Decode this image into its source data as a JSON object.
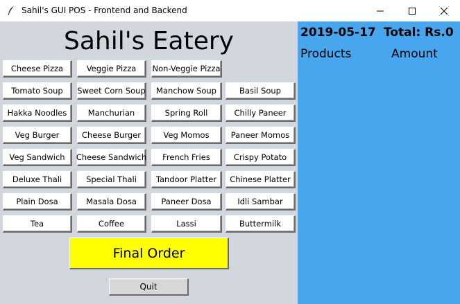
{
  "window": {
    "title": "Sahil's GUI POS - Frontend and Backend"
  },
  "shop": {
    "name": "Sahil's Eatery"
  },
  "menu": [
    [
      "Cheese Pizza",
      "Veggie Pizza",
      "Non-Veggie Pizza"
    ],
    [
      "Tomato Soup",
      "Sweet Corn Soup",
      "Manchow Soup",
      "Basil Soup"
    ],
    [
      "Hakka Noodles",
      "Manchurian",
      "Spring Roll",
      "Chilly Paneer"
    ],
    [
      "Veg Burger",
      "Cheese Burger",
      "Veg Momos",
      "Paneer Momos"
    ],
    [
      "Veg Sandwich",
      "Cheese Sandwich",
      "French Fries",
      "Crispy Potato"
    ],
    [
      "Deluxe Thali",
      "Special Thali",
      "Tandoor Platter",
      "Chinese Platter"
    ],
    [
      "Plain Dosa",
      "Masala Dosa",
      "Paneer Dosa",
      "Idli Sambar"
    ],
    [
      "Tea",
      "Coffee",
      "Lassi",
      "Buttermilk"
    ]
  ],
  "actions": {
    "final_order": "Final Order",
    "quit": "Quit"
  },
  "order": {
    "date": "2019-05-17",
    "total": "Total: Rs.0",
    "products_header": "Products",
    "amount_header": "Amount"
  },
  "colors": {
    "left_bg": "#d2d7df",
    "right_bg": "#47a6ee",
    "final_order_bg": "#ffff00"
  }
}
